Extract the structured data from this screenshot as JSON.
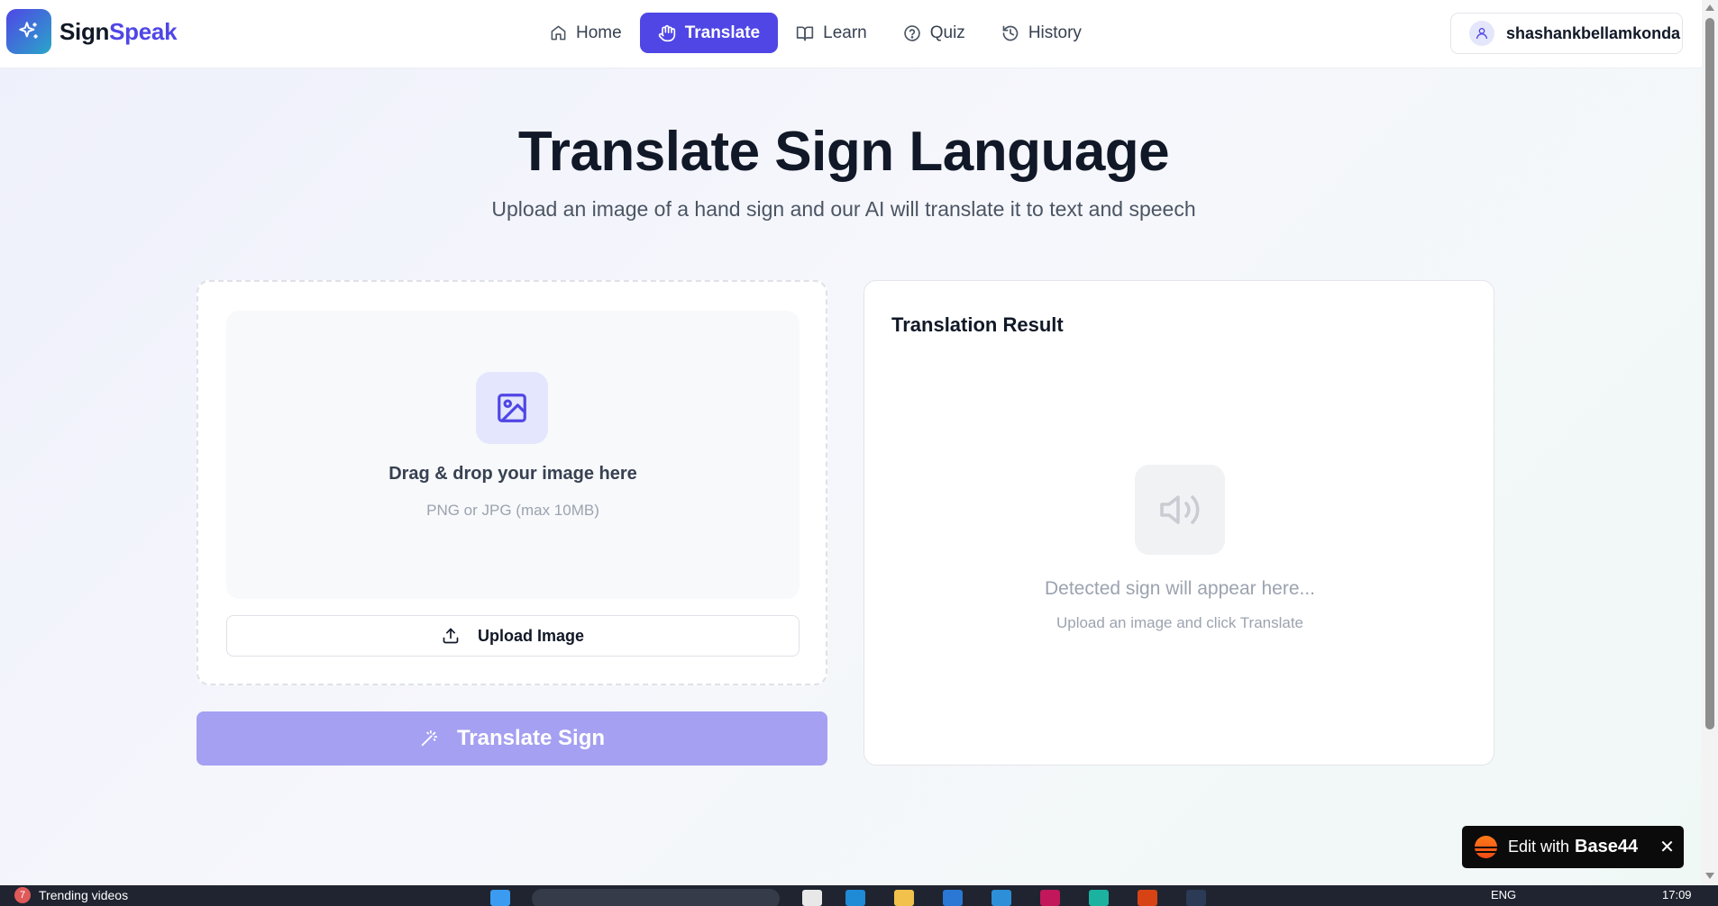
{
  "brand": {
    "name_part1": "Sign",
    "name_part2": "Speak"
  },
  "nav": {
    "items": [
      {
        "label": "Home",
        "icon": "home-icon"
      },
      {
        "label": "Translate",
        "icon": "hand-icon",
        "active": true
      },
      {
        "label": "Learn",
        "icon": "book-open-icon"
      },
      {
        "label": "Quiz",
        "icon": "help-circle-icon"
      },
      {
        "label": "History",
        "icon": "history-icon"
      }
    ]
  },
  "user": {
    "name": "shashankbellamkonda"
  },
  "hero": {
    "title": "Translate Sign Language",
    "subtitle": "Upload an image of a hand sign and our AI will translate it to text and speech"
  },
  "upload": {
    "drop_title": "Drag & drop your image here",
    "drop_hint": "PNG or JPG (max 10MB)",
    "upload_button": "Upload Image"
  },
  "translate_button": "Translate Sign",
  "result": {
    "title": "Translation Result",
    "empty_text": "Detected sign will appear here...",
    "hint": "Upload an image and click Translate"
  },
  "base44": {
    "prefix": "Edit with",
    "brand": "Base44",
    "close": "✕"
  },
  "taskbar": {
    "news_badge": "7",
    "news_label": "Trending videos",
    "language": "ENG",
    "time": "17:09"
  },
  "colors": {
    "accent": "#4f46e5",
    "translate_disabled": "#a5a0f1",
    "base44_orange": "#f04a14"
  }
}
